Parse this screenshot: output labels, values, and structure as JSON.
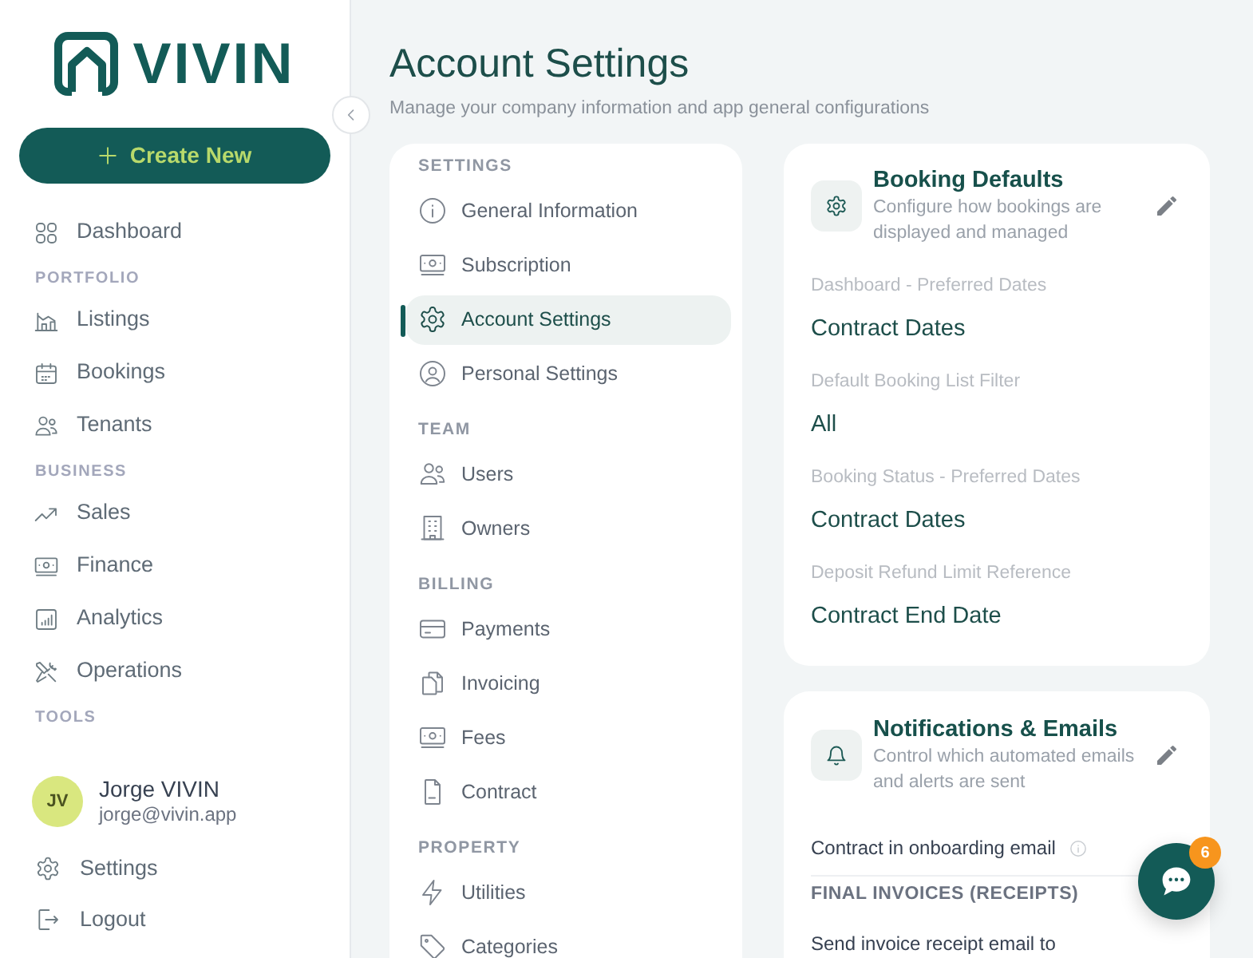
{
  "sidebar": {
    "logo": {
      "text": "VIVIN"
    },
    "create_button": {
      "label": "Create New"
    },
    "nav": [
      {
        "items": [
          {
            "label": "Dashboard",
            "selected": false
          }
        ]
      },
      {
        "heading": "PORTFOLIO",
        "items": [
          {
            "label": "Listings",
            "selected": false
          },
          {
            "label": "Bookings",
            "selected": false
          },
          {
            "label": "Tenants",
            "selected": false
          }
        ]
      },
      {
        "heading": "BUSINESS",
        "items": [
          {
            "label": "Sales",
            "selected": false
          },
          {
            "label": "Finance",
            "selected": false
          },
          {
            "label": "Analytics",
            "selected": false
          },
          {
            "label": "Operations",
            "selected": false
          }
        ]
      },
      {
        "heading": "TOOLS"
      }
    ],
    "user": {
      "initials": "JV",
      "name": "Jorge VIVIN",
      "email": "jorge@vivin.app"
    },
    "footer_links": [
      {
        "label": "Settings"
      },
      {
        "label": "Logout"
      }
    ]
  },
  "page": {
    "title": "Account Settings",
    "subtitle": "Manage your company information and app general configurations"
  },
  "settings_menu": [
    {
      "heading": "SETTINGS",
      "items": [
        {
          "label": "General Information",
          "selected": false
        },
        {
          "label": "Subscription",
          "selected": false
        },
        {
          "label": "Account Settings",
          "selected": true
        },
        {
          "label": "Personal Settings",
          "selected": false
        }
      ]
    },
    {
      "heading": "TEAM",
      "items": [
        {
          "label": "Users",
          "selected": false
        },
        {
          "label": "Owners",
          "selected": false
        }
      ]
    },
    {
      "heading": "BILLING",
      "items": [
        {
          "label": "Payments",
          "selected": false
        },
        {
          "label": "Invoicing",
          "selected": false
        },
        {
          "label": "Fees",
          "selected": false
        },
        {
          "label": "Contract",
          "selected": false
        }
      ]
    },
    {
      "heading": "PROPERTY",
      "items": [
        {
          "label": "Utilities",
          "selected": false
        },
        {
          "label": "Categories",
          "selected": false
        }
      ]
    }
  ],
  "cards": [
    {
      "title": "Booking Defaults",
      "description": "Configure how bookings are displayed and managed",
      "fields": [
        {
          "label": "Dashboard - Preferred Dates",
          "value": "Contract Dates"
        },
        {
          "label": "Default Booking List Filter",
          "value": "All"
        },
        {
          "label": "Booking Status - Preferred Dates",
          "value": "Contract Dates"
        },
        {
          "label": "Deposit Refund Limit Reference",
          "value": "Contract End Date"
        }
      ]
    },
    {
      "title": "Notifications & Emails",
      "description": "Control which automated emails and alerts are sent",
      "rows": [
        {
          "kind": "setting",
          "label": "Contract in onboarding email",
          "info": true
        },
        {
          "kind": "section",
          "label": "FINAL INVOICES (RECEIPTS)"
        },
        {
          "kind": "setting",
          "label": "Send invoice receipt email to",
          "info": false
        }
      ]
    }
  ],
  "chat_button": {
    "badge": "6"
  }
}
